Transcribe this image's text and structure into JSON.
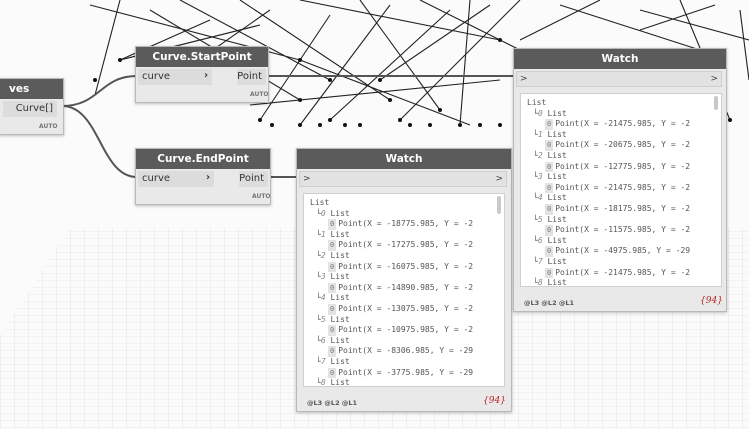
{
  "nodes": {
    "curves_partial": {
      "title_partial": "ves",
      "output": "Curve[]",
      "auto": "AUTO"
    },
    "start_point": {
      "title": "Curve.StartPoint",
      "input": "curve",
      "output": "Point",
      "auto": "AUTO"
    },
    "end_point": {
      "title": "Curve.EndPoint",
      "input": "curve",
      "output": "Point",
      "auto": "AUTO"
    }
  },
  "watch_left": {
    "title": "Watch",
    "port_in": ">",
    "port_out": ">",
    "root": "List",
    "items": [
      {
        "index": "0",
        "label": "List",
        "value": "Point(X = -18775.985, Y = -2"
      },
      {
        "index": "1",
        "label": "List",
        "value": "Point(X = -17275.985, Y = -2"
      },
      {
        "index": "2",
        "label": "List",
        "value": "Point(X = -16075.985, Y = -2"
      },
      {
        "index": "3",
        "label": "List",
        "value": "Point(X = -14890.985, Y = -2"
      },
      {
        "index": "4",
        "label": "List",
        "value": "Point(X = -13075.985, Y = -2"
      },
      {
        "index": "5",
        "label": "List",
        "value": "Point(X = -10975.985, Y = -2"
      },
      {
        "index": "6",
        "label": "List",
        "value": "Point(X = -8306.985, Y = -29"
      },
      {
        "index": "7",
        "label": "List",
        "value": "Point(X = -3775.985, Y = -29"
      },
      {
        "index": "8",
        "label": "List",
        "value": ""
      }
    ],
    "levels": "@L3 @L2 @L1",
    "count": "{94}"
  },
  "watch_right": {
    "title": "Watch",
    "port_in": ">",
    "port_out": ">",
    "root": "List",
    "items": [
      {
        "index": "0",
        "label": "List",
        "value": "Point(X = -21475.985, Y = -2"
      },
      {
        "index": "1",
        "label": "List",
        "value": "Point(X = -20675.985, Y = -2"
      },
      {
        "index": "2",
        "label": "List",
        "value": "Point(X = -12775.985, Y = -2"
      },
      {
        "index": "3",
        "label": "List",
        "value": "Point(X = -21475.985, Y = -2"
      },
      {
        "index": "4",
        "label": "List",
        "value": "Point(X = -18175.985, Y = -2"
      },
      {
        "index": "5",
        "label": "List",
        "value": "Point(X = -11575.985, Y = -2"
      },
      {
        "index": "6",
        "label": "List",
        "value": "Point(X = -4975.985, Y = -29"
      },
      {
        "index": "7",
        "label": "List",
        "value": "Point(X = -21475.985, Y = -2"
      },
      {
        "index": "8",
        "label": "List",
        "value": ""
      }
    ],
    "levels": "@L3 @L2 @L1",
    "count": "{94}"
  }
}
